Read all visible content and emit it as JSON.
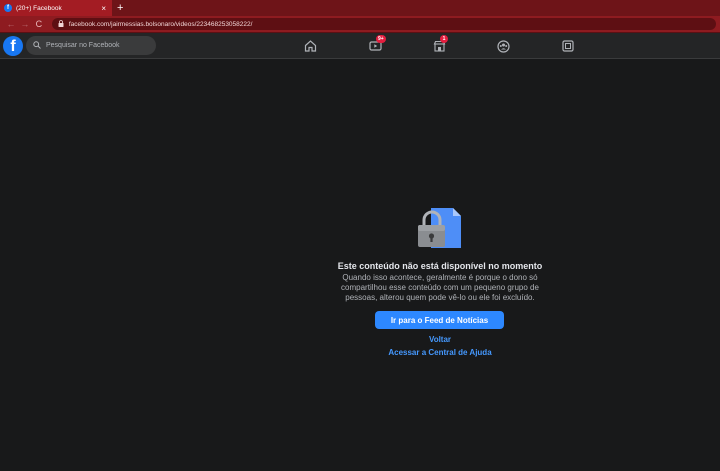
{
  "browser": {
    "tab_title": "(20+) Facebook",
    "tab_favicon": "f",
    "tab_close": "×",
    "new_tab": "+",
    "back": "←",
    "forward": "→",
    "reload": "C",
    "url": "facebook.com/jairmessias.bolsonaro/videos/223468253058222/"
  },
  "facebook": {
    "logo": "f",
    "search_placeholder": "Pesquisar no Facebook",
    "nav": {
      "watch_badge": "9+",
      "marketplace_badge": "1"
    }
  },
  "content": {
    "title": "Este conteúdo não está disponível no momento",
    "body": "Quando isso acontece, geralmente é porque o dono só compartilhou esse conteúdo com um pequeno grupo de pessoas, alterou quem pode vê-lo ou ele foi excluído.",
    "primary_button": "Ir para o Feed de Notícias",
    "back_link": "Voltar",
    "help_link": "Acessar a Central de Ajuda"
  },
  "colors": {
    "chrome_tabstrip": "#6e1418",
    "chrome_toolbar": "#8e1b20",
    "fb_blue": "#1877f2",
    "page_bg": "#18191a",
    "link": "#4599ff",
    "badge": "#e41e3f"
  }
}
